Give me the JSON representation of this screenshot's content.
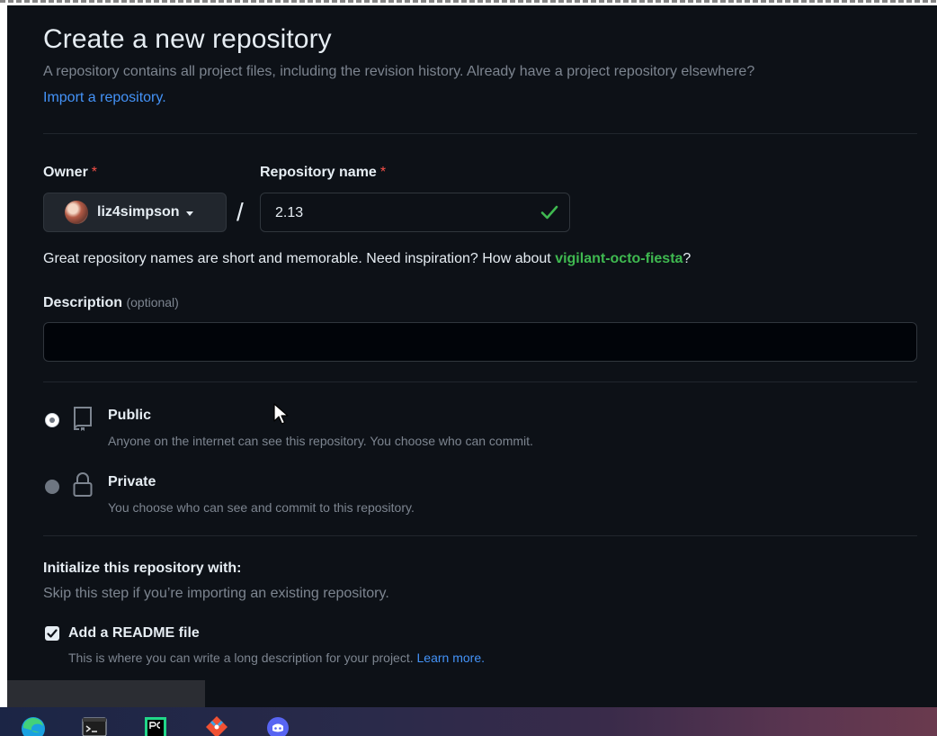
{
  "header": {
    "title": "Create a new repository",
    "intro": "A repository contains all project files, including the revision history. Already have a project repository elsewhere?",
    "import_link": "Import a repository."
  },
  "owner": {
    "label": "Owner",
    "required_mark": "*",
    "value": "liz4simpson"
  },
  "repo_name": {
    "label": "Repository name",
    "required_mark": "*",
    "value": "2.13",
    "separator": "/"
  },
  "hint": {
    "text": "Great repository names are short and memorable. Need inspiration? How about ",
    "suggestion": "vigilant-octo-fiesta",
    "tail": "?"
  },
  "description": {
    "label": "Description",
    "optional": "(optional)",
    "value": ""
  },
  "visibility": {
    "public_title": "Public",
    "public_desc": "Anyone on the internet can see this repository. You choose who can commit.",
    "private_title": "Private",
    "private_desc": "You choose who can see and commit to this repository.",
    "selected": "Public"
  },
  "init": {
    "title": "Initialize this repository with:",
    "subtitle": "Skip this step if you’re importing an existing repository.",
    "readme_label": "Add a README file",
    "readme_desc": "This is where you can write a long description for your project. ",
    "learn_more": "Learn more.",
    "readme_checked": true
  },
  "taskbar": {
    "icons": [
      "edge-icon",
      "terminal-icon",
      "pycharm-icon",
      "git-icon",
      "discord-icon"
    ]
  },
  "colors": {
    "background": "#0d1117",
    "link": "#4493f8",
    "success": "#3fb950",
    "required": "#f85149"
  }
}
